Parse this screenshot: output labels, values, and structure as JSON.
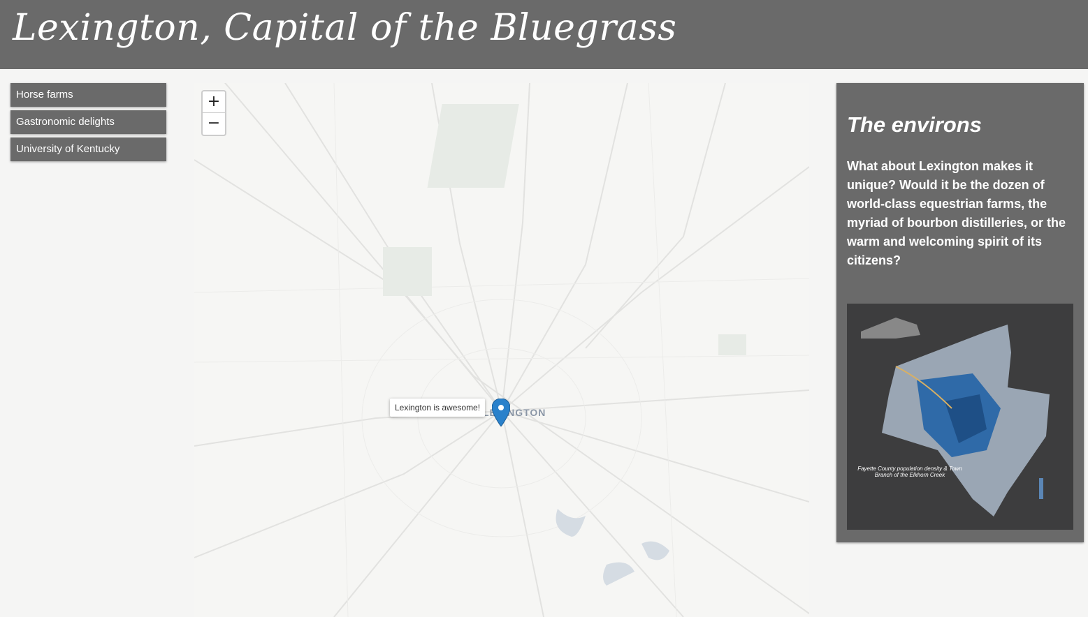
{
  "header": {
    "title": "Lexington, Capital of the Bluegrass"
  },
  "nav": {
    "items": [
      "Horse farms",
      "Gastronomic delights",
      "University of Kentucky"
    ]
  },
  "map": {
    "zoom_in": "+",
    "zoom_out": "−",
    "city_label": "LEXINGTON",
    "popup": "Lexington is awesome!",
    "marker_color": "#2a81cb"
  },
  "panel": {
    "title": "The environs",
    "body": "What about Lexington makes it unique? Would it be the dozen of world-class equestrian farms, the myriad of bourbon distilleries, or the warm and welcoming spirit of its citizens?",
    "image_caption": "Fayette County population density & Town Branch of the Elkhorn Creek"
  }
}
